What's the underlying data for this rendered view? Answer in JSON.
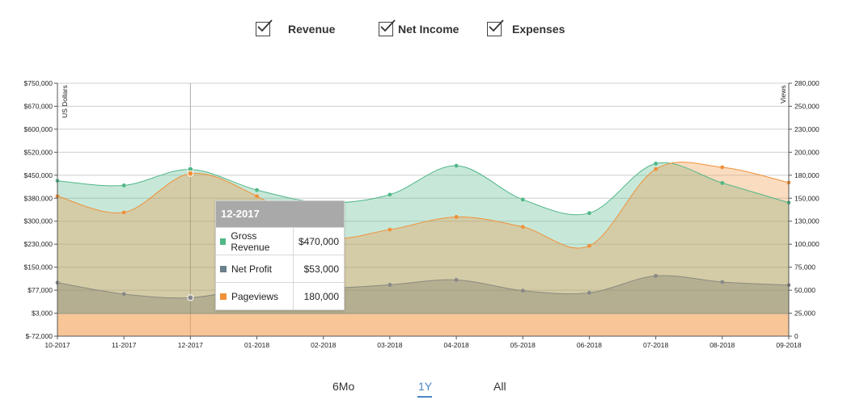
{
  "legend": [
    {
      "label": "Revenue",
      "checked": true
    },
    {
      "label": "Net Income",
      "checked": true
    },
    {
      "label": "Expenses",
      "checked": true
    }
  ],
  "tooltip": {
    "title": "12-2017",
    "rows": [
      {
        "name": "Gross Revenue",
        "value": "$470,000",
        "color": "#52b788"
      },
      {
        "name": "Net Profit",
        "value": "$53,000",
        "color": "#6b7f8c"
      },
      {
        "name": "Pageviews",
        "value": "180,000",
        "color": "#f0913a"
      }
    ]
  },
  "ranges": [
    {
      "label": "6Mo",
      "active": false
    },
    {
      "label": "1Y",
      "active": true
    },
    {
      "label": "All",
      "active": false
    }
  ],
  "colors": {
    "revenue": "#52b788",
    "net_profit": "#7a7a6e",
    "pageviews": "#f0913a",
    "active_range": "#4a86c8"
  },
  "chart_data": {
    "type": "area",
    "x": [
      "10-2017",
      "11-2017",
      "12-2017",
      "01-2018",
      "02-2018",
      "03-2018",
      "04-2018",
      "05-2018",
      "06-2018",
      "07-2018",
      "08-2018",
      "09-2018"
    ],
    "ylabel": "US Dollars",
    "y2label": "Views",
    "y_ticks": [
      "$750,000",
      "$670,000",
      "$600,000",
      "$520,000",
      "$450,000",
      "$380,000",
      "$300,000",
      "$230,000",
      "$150,000",
      "$77,000",
      "$3,000",
      "$-72,000"
    ],
    "y2_ticks": [
      "280,000",
      "250,000",
      "230,000",
      "200,000",
      "180,000",
      "150,000",
      "130,000",
      "100,000",
      "75,000",
      "50,000",
      "25,000",
      "0"
    ],
    "ylim": [
      -72000,
      750000
    ],
    "y2lim": [
      0,
      280000
    ],
    "highlight_x": "12-2017",
    "series": [
      {
        "name": "Gross Revenue",
        "axis": "left",
        "values": [
          433000,
          418000,
          470000,
          403000,
          362000,
          388000,
          482000,
          372000,
          328000,
          489000,
          426000,
          362000
        ]
      },
      {
        "name": "Net Profit",
        "axis": "left",
        "values": [
          102000,
          65000,
          53000,
          85000,
          83000,
          95000,
          111000,
          76000,
          69000,
          124000,
          104000,
          94000
        ]
      },
      {
        "name": "Pageviews",
        "axis": "right",
        "values": [
          155000,
          137000,
          180000,
          155000,
          110000,
          118000,
          132000,
          121000,
          100000,
          185000,
          187000,
          170000
        ]
      }
    ]
  }
}
